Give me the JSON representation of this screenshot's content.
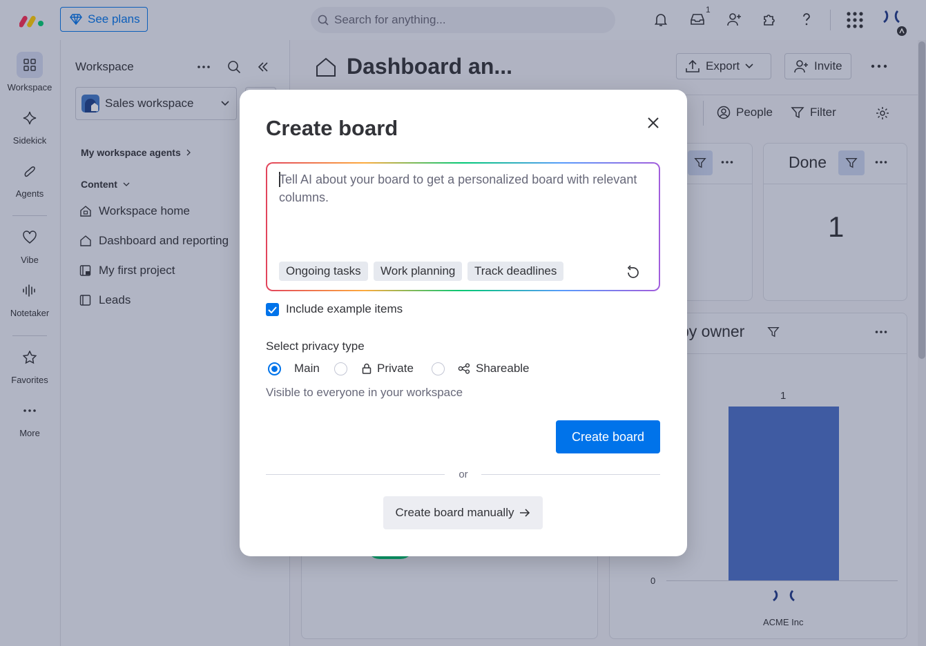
{
  "topbar": {
    "plans_label": "See plans",
    "search_placeholder": "Search for anything...",
    "inbox_badge": "1"
  },
  "rail": {
    "items": [
      {
        "label": "Workspace",
        "icon": "grid-icon"
      },
      {
        "label": "Sidekick",
        "icon": "sparkle-icon"
      },
      {
        "label": "Agents",
        "icon": "agent-icon"
      },
      {
        "label": "Vibe",
        "icon": "heart-icon"
      },
      {
        "label": "Notetaker",
        "icon": "soundwave-icon"
      },
      {
        "label": "Favorites",
        "icon": "star-icon"
      },
      {
        "label": "More",
        "icon": "more-dots-icon"
      }
    ]
  },
  "workspace_panel": {
    "title": "Workspace",
    "workspace_name": "Sales workspace",
    "agents_link": "My workspace agents",
    "content_label": "Content",
    "nav": [
      {
        "label": "Workspace home",
        "icon": "home-lock-icon"
      },
      {
        "label": "Dashboard and reporting",
        "icon": "home-icon"
      },
      {
        "label": "My first project",
        "icon": "board-lock-icon"
      },
      {
        "label": "Leads",
        "icon": "board-icon"
      }
    ]
  },
  "main": {
    "title": "Dashboard an...",
    "export_label": "Export",
    "invite_label": "Invite",
    "people_label": "People",
    "filter_label": "Filter",
    "done_title": "Done",
    "done_value": "1",
    "owner_widget_title": "by owner",
    "bar_value_label": "1",
    "axis_zero": "0",
    "bar_category": "ACME Inc"
  },
  "modal": {
    "title": "Create board",
    "ai_placeholder": "Tell AI about your board to get a personalized board with relevant columns.",
    "chips": [
      "Ongoing tasks",
      "Work planning",
      "Track deadlines"
    ],
    "include_examples_label": "Include example items",
    "include_examples_checked": true,
    "privacy_label": "Select privacy type",
    "privacy_options": [
      {
        "label": "Main",
        "selected": true
      },
      {
        "label": "Private",
        "selected": false
      },
      {
        "label": "Shareable",
        "selected": false
      }
    ],
    "privacy_description": "Visible to everyone in your workspace",
    "create_button": "Create board",
    "or_label": "or",
    "manual_button": "Create board manually"
  },
  "colors": {
    "accent": "#0073ea",
    "bar": "#4a6fc8"
  }
}
